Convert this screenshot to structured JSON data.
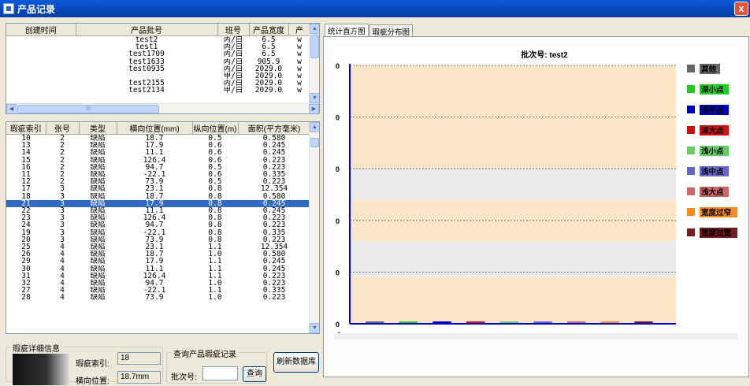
{
  "window": {
    "title": "产品记录",
    "close_label": "x"
  },
  "product_table": {
    "columns": [
      "创建时间",
      "产品批号",
      "班号",
      "产品宽度",
      "产"
    ],
    "rows": [
      {
        "time": "",
        "batch": "test2",
        "shift": "丙/白",
        "width": "6.5",
        "extra": "w"
      },
      {
        "time": "",
        "batch": "test1",
        "shift": "丙/白",
        "width": "6.5",
        "extra": "w"
      },
      {
        "time": "",
        "batch": "test1709",
        "shift": "丙/白",
        "width": "6.5",
        "extra": "w"
      },
      {
        "time": "",
        "batch": "test1633",
        "shift": "丙/白",
        "width": "905.9",
        "extra": "w"
      },
      {
        "time": "",
        "batch": "test0935",
        "shift": "丙/白",
        "width": "2029.0",
        "extra": "w"
      },
      {
        "time": "",
        "batch": "",
        "shift": "甲/白",
        "width": "2029.0",
        "extra": "w"
      },
      {
        "time": "",
        "batch": "test2155",
        "shift": "丙/白",
        "width": "2029.0",
        "extra": "w"
      },
      {
        "time": "",
        "batch": "test2134",
        "shift": "甲/白",
        "width": "2029.0",
        "extra": "w"
      }
    ],
    "hscroll_label": "III"
  },
  "defect_table": {
    "columns": [
      "瑕疵索引",
      "张号",
      "类型",
      "横向位置(mm)",
      "纵向位置(m)",
      "面积(平方毫米)"
    ],
    "selected_index": 9,
    "rows": [
      [
        "10",
        "2",
        "缺陷",
        "18.7",
        "0.5",
        "0.580"
      ],
      [
        "13",
        "2",
        "缺陷",
        "17.9",
        "0.6",
        "0.245"
      ],
      [
        "14",
        "2",
        "缺陷",
        "11.1",
        "0.6",
        "0.245"
      ],
      [
        "15",
        "2",
        "缺陷",
        "126.4",
        "0.6",
        "0.223"
      ],
      [
        "16",
        "2",
        "缺陷",
        "94.7",
        "0.5",
        "0.223"
      ],
      [
        "11",
        "2",
        "缺陷",
        "-22.1",
        "0.6",
        "0.335"
      ],
      [
        "12",
        "2",
        "缺陷",
        "73.9",
        "0.5",
        "0.223"
      ],
      [
        "17",
        "3",
        "缺陷",
        "23.1",
        "0.8",
        "12.354"
      ],
      [
        "18",
        "3",
        "缺陷",
        "18.7",
        "0.8",
        "0.580"
      ],
      [
        "21",
        "3",
        "缺陷",
        "17.9",
        "0.8",
        "0.245"
      ],
      [
        "22",
        "3",
        "缺陷",
        "11.1",
        "0.8",
        "0.245"
      ],
      [
        "23",
        "3",
        "缺陷",
        "126.4",
        "0.8",
        "0.223"
      ],
      [
        "24",
        "3",
        "缺陷",
        "94.7",
        "0.8",
        "0.223"
      ],
      [
        "19",
        "3",
        "缺陷",
        "-22.1",
        "0.8",
        "0.335"
      ],
      [
        "20",
        "3",
        "缺陷",
        "73.9",
        "0.8",
        "0.223"
      ],
      [
        "25",
        "4",
        "缺陷",
        "23.1",
        "1.1",
        "12.354"
      ],
      [
        "26",
        "4",
        "缺陷",
        "18.7",
        "1.0",
        "0.580"
      ],
      [
        "29",
        "4",
        "缺陷",
        "17.9",
        "1.1",
        "0.245"
      ],
      [
        "30",
        "4",
        "缺陷",
        "11.1",
        "1.1",
        "0.245"
      ],
      [
        "31",
        "4",
        "缺陷",
        "126.4",
        "1.1",
        "0.223"
      ],
      [
        "32",
        "4",
        "缺陷",
        "94.7",
        "1.0",
        "0.223"
      ],
      [
        "27",
        "4",
        "缺陷",
        "-22.1",
        "1.1",
        "0.335"
      ],
      [
        "28",
        "4",
        "缺陷",
        "73.9",
        "1.0",
        "0.223"
      ]
    ]
  },
  "detail": {
    "group_label": "瑕疵详细信息",
    "index_label": "瑕疵索引:",
    "index_value": "18",
    "position_label": "横向位置:",
    "position_value": "18.7mm"
  },
  "query": {
    "group_label": "查询产品瑕疵记录",
    "batch_label": "批次号:",
    "batch_value": "",
    "query_button": "查询",
    "refresh_button": "刷新数据库"
  },
  "tabs": [
    {
      "label": "统计直方图",
      "active": true
    },
    {
      "label": "瑕疵分布图",
      "active": false
    }
  ],
  "chart_data": {
    "type": "bar",
    "title": "批次号: test2",
    "categories": [
      "其他",
      "深小点",
      "深中点",
      "深大点",
      "浅小点",
      "浅中点",
      "浅大点",
      "宽度过窄",
      "宽度过宽"
    ],
    "colors": [
      "#666666",
      "#22cc22",
      "#0000bb",
      "#cc1111",
      "#66cc66",
      "#6666cc",
      "#cc6666",
      "#ff8822",
      "#771c1c"
    ],
    "values": [
      0,
      0,
      0,
      0,
      0,
      0,
      0,
      0,
      0
    ],
    "yticks": [
      "0",
      "0",
      "0",
      "0",
      "0",
      "0"
    ],
    "ylim": [
      0,
      0
    ],
    "grid": true,
    "legend": "right"
  }
}
